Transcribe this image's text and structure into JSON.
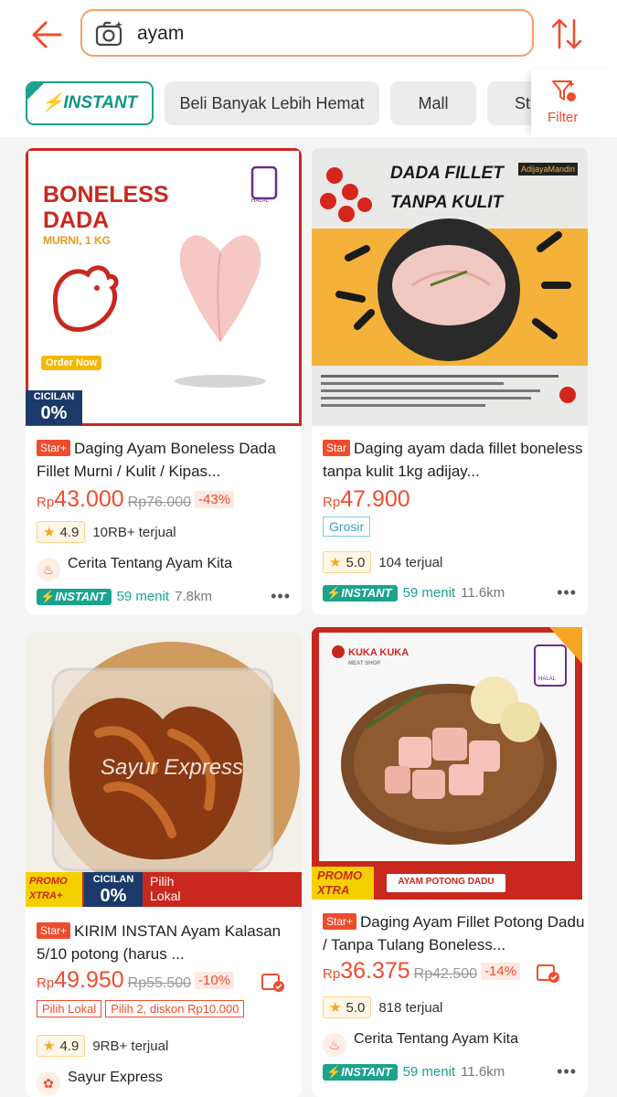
{
  "search": {
    "query": "ayam"
  },
  "chips": [
    "INSTANT",
    "Beli Banyak Lebih Hemat",
    "Mall",
    "St"
  ],
  "filter_label": "Filter",
  "products": [
    {
      "image_text": {
        "headline1": "BONELESS",
        "headline2": "DADA",
        "sub": "MURNI, 1 KG",
        "order": "Order Now",
        "cicilan": "CICILAN",
        "zero": "0%",
        "halal": "HALAL"
      },
      "badge": "Star+",
      "title": "Daging Ayam Boneless Dada Fillet Murni / Kulit / Kipas...",
      "price_prefix": "Rp",
      "price": "43.000",
      "old_price": "Rp76.000",
      "discount": "-43%",
      "rating": "4.9",
      "sold": "10RB+ terjual",
      "shop": "Cerita Tentang Ayam Kita",
      "delivery_tag": "INSTANT",
      "delivery_time": "59 menit",
      "distance": "7.8km"
    },
    {
      "image_text": {
        "headline1": "DADA FILLET",
        "headline2": "TANPA KULIT",
        "brand": "AdijayaMandiri"
      },
      "badge": "Star",
      "title": "Daging ayam dada fillet boneless tanpa kulit 1kg adijay...",
      "price_prefix": "Rp",
      "price": "47.900",
      "grosir": "Grosir",
      "rating": "5.0",
      "sold": "104 terjual",
      "delivery_tag": "INSTANT",
      "delivery_time": "59 menit",
      "distance": "11.6km"
    },
    {
      "image_text": {
        "watermark": "Sayur Express",
        "promo1": "PROMO",
        "promo2": "XTRA+",
        "cicilan": "CICILAN",
        "zero": "0%",
        "pilih1": "Pilih",
        "pilih2": "Lokal"
      },
      "badge": "Star+",
      "title": "KIRIM INSTAN Ayam Kalasan 5/10 potong (harus ...",
      "price_prefix": "Rp",
      "price": "49.950",
      "old_price": "Rp55.500",
      "discount": "-10%",
      "tags": [
        "Pilih Lokal",
        "Pilih 2, diskon Rp10.000"
      ],
      "rating": "4.9",
      "sold": "9RB+ terjual",
      "shop": "Sayur Express"
    },
    {
      "image_text": {
        "brand": "KUKA KUKA",
        "brand_sub": "MEAT SHOP",
        "promo1": "PROMO",
        "promo2": "XTRA",
        "caption": "AYAM POTONG DADU",
        "halal": "HALAL"
      },
      "badge": "Star+",
      "title": "Daging Ayam Fillet Potong Dadu / Tanpa Tulang Boneless...",
      "price_prefix": "Rp",
      "price": "36.375",
      "old_price": "Rp42.500",
      "discount": "-14%",
      "rating": "5.0",
      "sold": "818 terjual",
      "shop": "Cerita Tentang Ayam Kita",
      "delivery_tag": "INSTANT",
      "delivery_time": "59 menit",
      "distance": "11.6km"
    }
  ]
}
